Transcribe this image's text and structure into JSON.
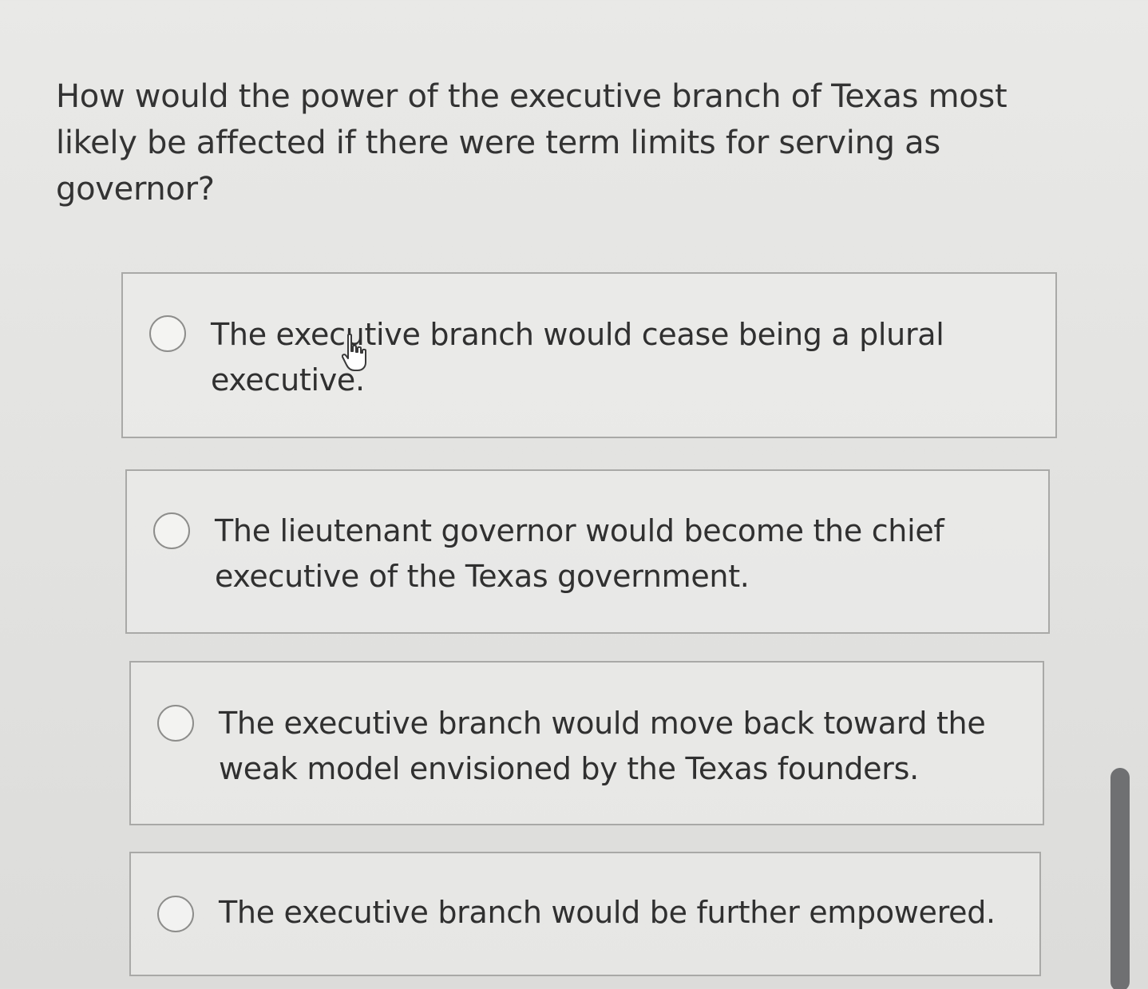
{
  "question": {
    "text": "How would the power of the executive branch of Texas most likely be affected if there were term limits for serving as governor?"
  },
  "options": [
    {
      "label": "The executive branch would cease being a plural executive.",
      "selected": false
    },
    {
      "label": "The lieutenant governor would become the chief executive of the Texas government.",
      "selected": false
    },
    {
      "label": "The executive branch would move back toward the weak model envisioned by the Texas founders.",
      "selected": false
    },
    {
      "label": "The executive branch would be further empowered.",
      "selected": false
    }
  ],
  "icons": {
    "cursor": "hand-pointer-icon"
  },
  "colors": {
    "background": "#e5e5e3",
    "border": "#a9a9a7",
    "text": "#303030",
    "scrollbar": "#6f7072"
  }
}
